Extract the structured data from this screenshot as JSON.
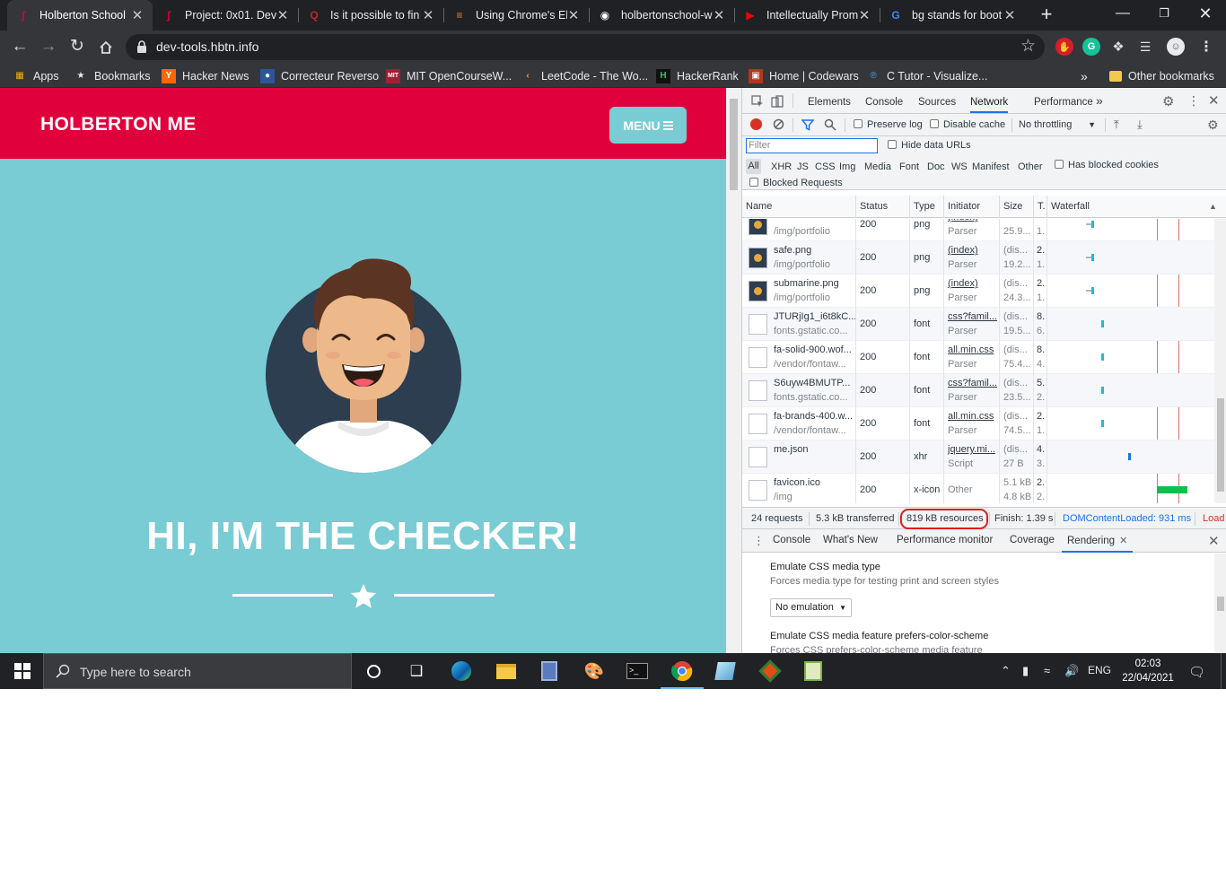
{
  "browser": {
    "tabs": [
      {
        "title": "Holberton School",
        "active": true,
        "favicon": "holberton-icon"
      },
      {
        "title": "Project: 0x01. Deve",
        "active": false,
        "favicon": "holberton-icon"
      },
      {
        "title": "Is it possible to fin",
        "active": false,
        "favicon": "quora-icon"
      },
      {
        "title": "Using Chrome's El",
        "active": false,
        "favicon": "stackoverflow-icon"
      },
      {
        "title": "holbertonschool-w",
        "active": false,
        "favicon": "github-icon"
      },
      {
        "title": "Intellectually Prom",
        "active": false,
        "favicon": "youtube-icon"
      },
      {
        "title": "bg stands for boot",
        "active": false,
        "favicon": "google-icon"
      }
    ],
    "url": "dev-tools.hbtn.info",
    "bookmarks": [
      {
        "label": "Apps",
        "icon": "apps-grid-icon"
      },
      {
        "label": "Bookmarks",
        "icon": "star-icon"
      },
      {
        "label": "Hacker News",
        "icon": "y-icon"
      },
      {
        "label": "Correcteur Reverso",
        "icon": "reverso-icon"
      },
      {
        "label": "MIT OpenCourseW...",
        "icon": "mit-icon"
      },
      {
        "label": "LeetCode - The Wo...",
        "icon": "leetcode-icon"
      },
      {
        "label": "HackerRank",
        "icon": "hackerrank-icon"
      },
      {
        "label": "Home | Codewars",
        "icon": "codewars-icon"
      },
      {
        "label": "C Tutor - Visualize...",
        "icon": "python-icon"
      }
    ],
    "bookmarks_more": "»",
    "other_bookmarks": "Other bookmarks"
  },
  "page": {
    "brand": "HOLBERTON ME",
    "menu_label": "MENU",
    "hero_title": "HI, I'M THE CHECKER!",
    "colors": {
      "nav": "#e0003c",
      "bg": "#79ccd3"
    }
  },
  "devtools": {
    "tabs": [
      "Elements",
      "Console",
      "Sources",
      "Network",
      "Performance"
    ],
    "tabs_more": "»",
    "selected_tab": "Network",
    "toolbar": {
      "preserve_log": "Preserve log",
      "disable_cache": "Disable cache",
      "throttling": "No throttling"
    },
    "filter": {
      "placeholder": "Filter",
      "hide_data_urls": "Hide data URLs",
      "types": [
        "All",
        "XHR",
        "JS",
        "CSS",
        "Img",
        "Media",
        "Font",
        "Doc",
        "WS",
        "Manifest",
        "Other"
      ],
      "has_blocked_cookies": "Has blocked cookies",
      "blocked_requests": "Blocked Requests"
    },
    "columns": [
      "Name",
      "Status",
      "Type",
      "Initiator",
      "Size",
      "T.",
      "Waterfall"
    ],
    "rows": [
      {
        "name": "",
        "path": "/img/portfolio",
        "status": "200",
        "type": "png",
        "initiator": "(index)",
        "initiator_sub": "Parser",
        "size": "",
        "size_sub": "25.9...",
        "time": "",
        "time_sub": "1.",
        "icon": "image-thumb-icon",
        "wf": 0.83,
        "wfcolor": "#1bbcd6"
      },
      {
        "name": "safe.png",
        "path": "/img/portfolio",
        "status": "200",
        "type": "png",
        "initiator": "(index)",
        "initiator_sub": "Parser",
        "size": "(dis...",
        "size_sub": "19.2...",
        "time": "2.",
        "time_sub": "1.",
        "icon": "image-thumb-icon",
        "wf": 0.83,
        "wfcolor": "#1bbcd6"
      },
      {
        "name": "submarine.png",
        "path": "/img/portfolio",
        "status": "200",
        "type": "png",
        "initiator": "(index)",
        "initiator_sub": "Parser",
        "size": "(dis...",
        "size_sub": "24.3...",
        "time": "2.",
        "time_sub": "1.",
        "icon": "image-thumb-icon",
        "wf": 0.83,
        "wfcolor": "#1bbcd6"
      },
      {
        "name": "JTURjIg1_i6t8kC...",
        "path": "fonts.gstatic.co...",
        "status": "200",
        "type": "font",
        "initiator": "css?famil...",
        "initiator_sub": "Parser",
        "size": "(dis...",
        "size_sub": "19.5...",
        "time": "8.",
        "time_sub": "6.",
        "icon": "file-icon",
        "wf": 0.9,
        "wfcolor": "#1bbcd6"
      },
      {
        "name": "fa-solid-900.wof...",
        "path": "/vendor/fontaw...",
        "status": "200",
        "type": "font",
        "initiator": "all.min.css",
        "initiator_sub": "Parser",
        "size": "(dis...",
        "size_sub": "75.4...",
        "time": "8.",
        "time_sub": "4.",
        "icon": "file-icon",
        "wf": 0.9,
        "wfcolor": "#1bbcd6"
      },
      {
        "name": "S6uyw4BMUTP...",
        "path": "fonts.gstatic.co...",
        "status": "200",
        "type": "font",
        "initiator": "css?famil...",
        "initiator_sub": "Parser",
        "size": "(dis...",
        "size_sub": "23.5...",
        "time": "5.",
        "time_sub": "2.",
        "icon": "file-icon",
        "wf": 0.9,
        "wfcolor": "#1bbcd6"
      },
      {
        "name": "fa-brands-400.w...",
        "path": "/vendor/fontaw...",
        "status": "200",
        "type": "font",
        "initiator": "all.min.css",
        "initiator_sub": "Parser",
        "size": "(dis...",
        "size_sub": "74.5...",
        "time": "2.",
        "time_sub": "1.",
        "icon": "file-icon",
        "wf": 0.9,
        "wfcolor": "#1bbcd6"
      },
      {
        "name": "me.json",
        "path": "",
        "status": "200",
        "type": "xhr",
        "initiator": "jquery.mi...",
        "initiator_sub": "Script",
        "size": "(dis...",
        "size_sub": "27 B",
        "time": "4.",
        "time_sub": "3.",
        "icon": "file-icon",
        "wf": 1.1,
        "wfcolor": "#1a73e8"
      },
      {
        "name": "favicon.ico",
        "path": "/img",
        "status": "200",
        "type": "x-icon",
        "initiator": "Other",
        "initiator_sub": "",
        "size": "5.1 kB",
        "size_sub": "4.8 kB",
        "time": "2.",
        "time_sub": "2.",
        "icon": "file-icon",
        "wf": 1.31,
        "wfcolor": "#0fc04e"
      }
    ],
    "summary": {
      "requests": "24 requests",
      "transferred": "5.3 kB transferred",
      "resources": "819 kB resources",
      "finish": "Finish: 1.39 s",
      "dom_loaded": "DOMContentLoaded: 931 ms",
      "load": "Load"
    },
    "drawer": {
      "tabs": [
        "Console",
        "What's New",
        "Performance monitor",
        "Coverage",
        "Rendering"
      ],
      "selected": "Rendering",
      "media_type_title": "Emulate CSS media type",
      "media_type_desc": "Forces media type for testing print and screen styles",
      "media_type_value": "No emulation",
      "color_scheme_title": "Emulate CSS media feature prefers-color-scheme",
      "color_scheme_desc": "Forces CSS prefers-color-scheme media feature"
    }
  },
  "taskbar": {
    "search_placeholder": "Type here to search",
    "language": "ENG",
    "time": "02:03",
    "date": "22/04/2021"
  }
}
